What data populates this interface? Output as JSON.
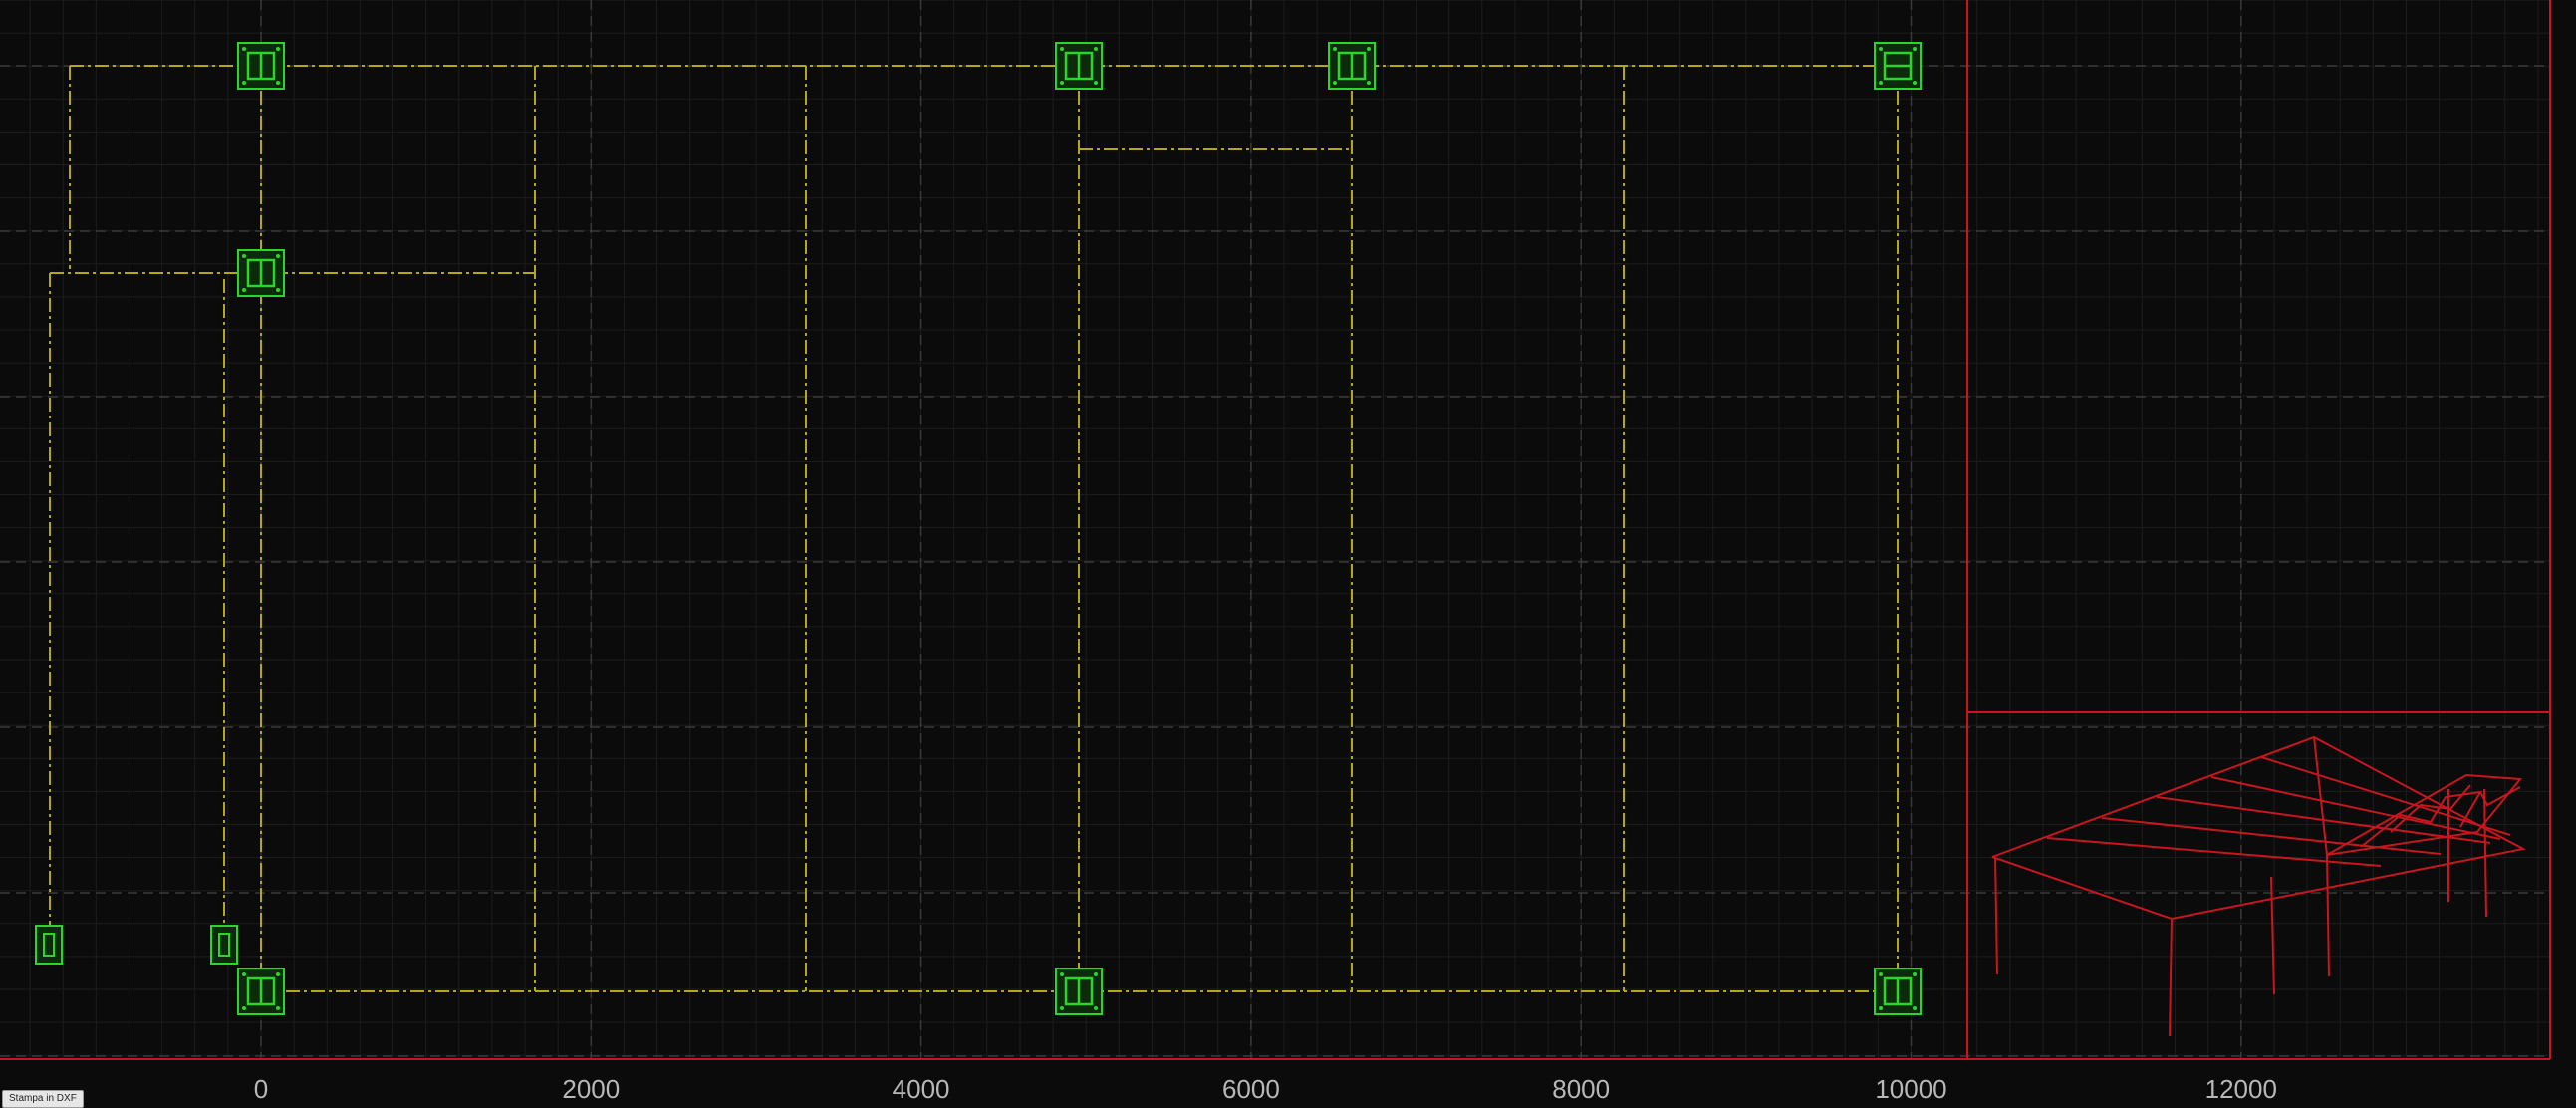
{
  "app": {
    "status_chip": "Stampa in DXF"
  },
  "x_axis": {
    "ticks": [
      "0",
      "2000",
      "4000",
      "6000",
      "8000",
      "10000",
      "12000"
    ]
  },
  "colors": {
    "background": "#0b0b0b",
    "grid_major": "#3a3a3a",
    "grid_minor": "#1d1d1d",
    "structure_lines": "#b5a818",
    "base_plates": "#2ad62a",
    "frame_3d": "#c8161e",
    "divider": "#c8161e"
  },
  "base_plates": [
    {
      "id": "P1",
      "shape": "square"
    },
    {
      "id": "P2",
      "shape": "square"
    },
    {
      "id": "P3",
      "shape": "square"
    },
    {
      "id": "P4",
      "shape": "square-h"
    },
    {
      "id": "P5",
      "shape": "square"
    },
    {
      "id": "P6",
      "shape": "square"
    },
    {
      "id": "P7",
      "shape": "square"
    },
    {
      "id": "P8",
      "shape": "square"
    },
    {
      "id": "P9",
      "shape": "narrow"
    },
    {
      "id": "P10",
      "shape": "narrow"
    }
  ],
  "view": {
    "panel_right": "3d-isometric-frame",
    "icons": [
      "base-plate-icon",
      "dxf-print-icon"
    ]
  }
}
